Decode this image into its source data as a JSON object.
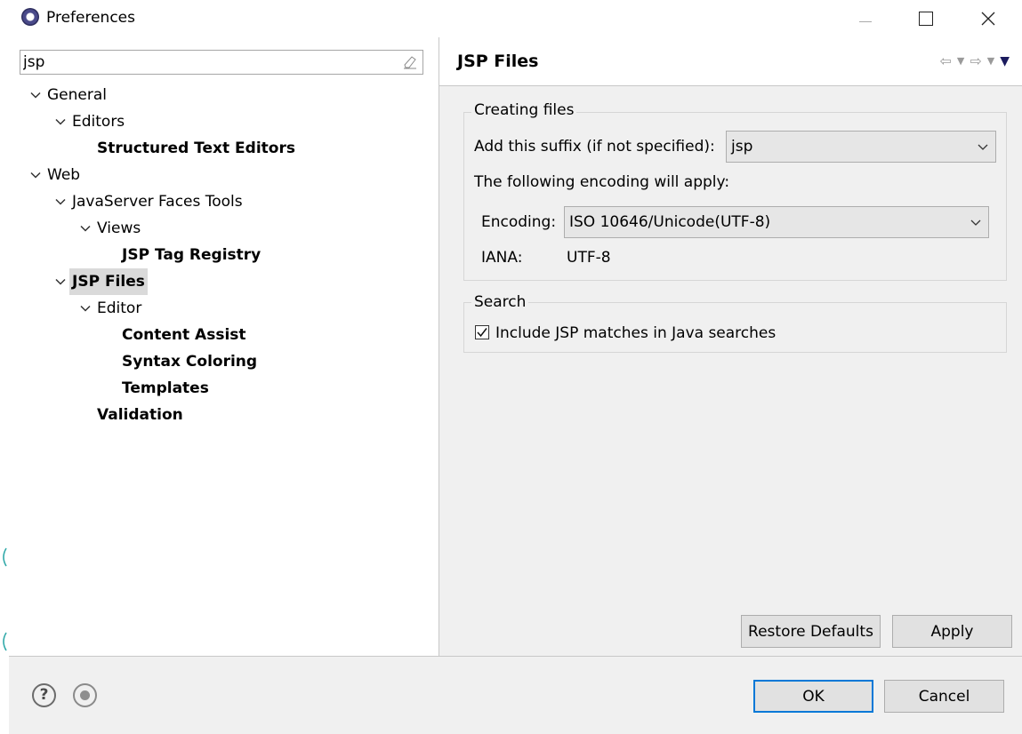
{
  "window": {
    "title": "Preferences"
  },
  "filter": {
    "value": "jsp"
  },
  "tree": [
    {
      "label": "General",
      "level": 0,
      "expanded": true,
      "bold": false,
      "selected": false
    },
    {
      "label": "Editors",
      "level": 1,
      "expanded": true,
      "bold": false,
      "selected": false
    },
    {
      "label": "Structured Text Editors",
      "level": 2,
      "expanded": null,
      "bold": true,
      "selected": false
    },
    {
      "label": "Web",
      "level": 0,
      "expanded": true,
      "bold": false,
      "selected": false
    },
    {
      "label": "JavaServer Faces Tools",
      "level": 1,
      "expanded": true,
      "bold": false,
      "selected": false
    },
    {
      "label": "Views",
      "level": 2,
      "expanded": true,
      "bold": false,
      "selected": false
    },
    {
      "label": "JSP Tag Registry",
      "level": 3,
      "expanded": null,
      "bold": true,
      "selected": false
    },
    {
      "label": "JSP Files",
      "level": 1,
      "expanded": true,
      "bold": true,
      "selected": true
    },
    {
      "label": "Editor",
      "level": 2,
      "expanded": true,
      "bold": false,
      "selected": false
    },
    {
      "label": "Content Assist",
      "level": 3,
      "expanded": null,
      "bold": true,
      "selected": false
    },
    {
      "label": "Syntax Coloring",
      "level": 3,
      "expanded": null,
      "bold": true,
      "selected": false
    },
    {
      "label": "Templates",
      "level": 3,
      "expanded": null,
      "bold": true,
      "selected": false
    },
    {
      "label": "Validation",
      "level": 2,
      "expanded": null,
      "bold": true,
      "selected": false
    }
  ],
  "page": {
    "title": "JSP Files",
    "creating_files": {
      "group_label": "Creating files",
      "suffix_label": "Add this suffix (if not specified):",
      "suffix_value": "jsp",
      "encoding_note": "The following encoding will apply:",
      "encoding_label": "Encoding:",
      "encoding_value": "ISO 10646/Unicode(UTF-8)",
      "iana_label": "IANA:",
      "iana_value": "UTF-8"
    },
    "search": {
      "group_label": "Search",
      "checkbox_label": "Include JSP matches in Java searches",
      "checked": true
    },
    "restore_defaults_label": "Restore Defaults",
    "apply_label": "Apply"
  },
  "footer": {
    "ok_label": "OK",
    "cancel_label": "Cancel",
    "help_glyph": "?"
  },
  "colors": {
    "accent": "#0078d7",
    "selection": "#dadada",
    "panel": "#f0f0f0"
  }
}
